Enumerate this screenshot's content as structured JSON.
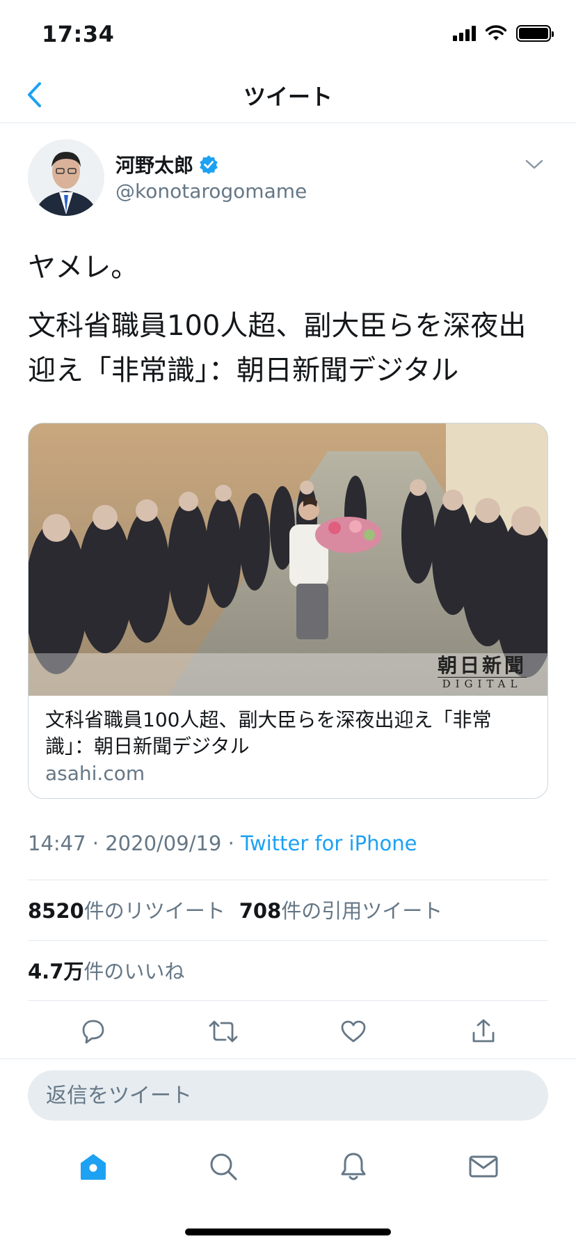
{
  "status_bar": {
    "time": "17:34"
  },
  "nav": {
    "title": "ツイート"
  },
  "tweet": {
    "author": {
      "display_name": "河野太郎",
      "handle": "@konotarogomame",
      "verified": true
    },
    "text": {
      "line1": "ヤメレ。",
      "line2": "文科省職員100人超、副大臣らを深夜出迎え「非常識」：朝日新聞デジタル"
    },
    "card": {
      "image_watermark": {
        "title": "朝日新聞",
        "subtitle": "DIGITAL"
      },
      "title": "文科省職員100人超、副大臣らを深夜出迎え「非常識」：朝日新聞デジタル",
      "domain": "asahi.com"
    },
    "meta": {
      "time": "14:47",
      "separator1": "·",
      "date": "2020/09/19",
      "separator2": "·",
      "source": "Twitter for iPhone"
    },
    "stats": {
      "retweets_count": "8520",
      "retweets_label": "件のリツイート",
      "quotes_count": "708",
      "quotes_label": "件の引用ツイート",
      "likes_count": "4.7万",
      "likes_label": "件のいいね"
    }
  },
  "actions": [
    "reply-icon",
    "retweet-icon",
    "like-icon",
    "share-icon"
  ],
  "reply": {
    "placeholder": "返信をツイート"
  },
  "tab_bar": {
    "tabs": [
      "home-icon",
      "search-icon",
      "notifications-icon",
      "messages-icon"
    ],
    "active": "home-icon"
  },
  "colors": {
    "accent": "#1da1f2",
    "text_primary": "#14171a",
    "text_secondary": "#657786",
    "divider": "#e1e8ed",
    "reply_bg": "#e6ecf0"
  }
}
